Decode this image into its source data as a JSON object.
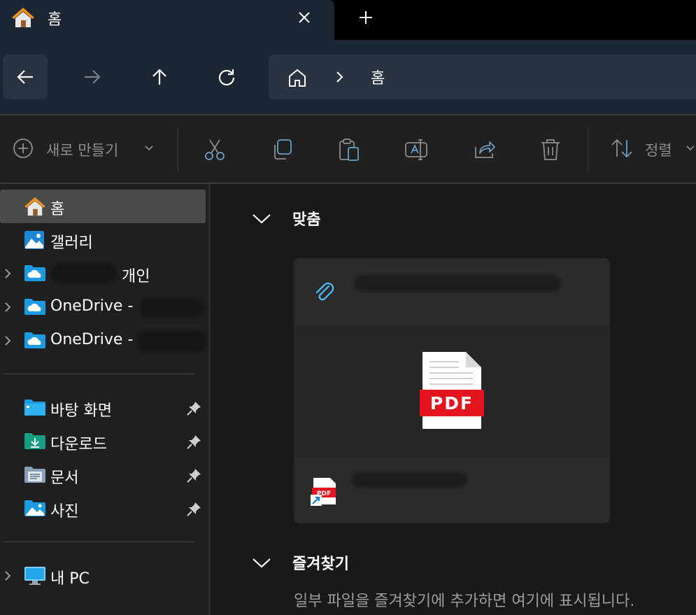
{
  "window": {
    "tab_title": "홈",
    "tab_close_icon": "close-icon",
    "new_tab_icon": "plus-icon"
  },
  "nav": {
    "back_icon": "arrow-left-icon",
    "forward_icon": "arrow-right-icon",
    "up_icon": "arrow-up-icon",
    "refresh_icon": "refresh-icon",
    "breadcrumb": {
      "home_icon": "home-icon",
      "separator": "›",
      "current": "홈"
    }
  },
  "toolbar": {
    "new_label": "새로 만들기",
    "cut_icon": "scissors-icon",
    "copy_icon": "copy-icon",
    "paste_icon": "clipboard-icon",
    "rename_icon": "rename-icon",
    "share_icon": "share-icon",
    "delete_icon": "trash-icon",
    "sort_label": "정렬"
  },
  "sidebar": {
    "items": [
      {
        "label": "홈",
        "icon": "home-icon",
        "selected": true
      },
      {
        "label": "갤러리",
        "icon": "gallery-icon"
      },
      {
        "label": "개인",
        "icon": "cloud-folder-icon",
        "expandable": true
      },
      {
        "label": "OneDrive -",
        "icon": "cloud-folder-icon",
        "expandable": true
      },
      {
        "label": "OneDrive -",
        "icon": "cloud-folder-icon",
        "expandable": true
      },
      {
        "label": "바탕 화면",
        "icon": "desktop-folder-icon",
        "pinned": true
      },
      {
        "label": "다운로드",
        "icon": "download-folder-icon",
        "pinned": true
      },
      {
        "label": "문서",
        "icon": "documents-folder-icon",
        "pinned": true
      },
      {
        "label": "사진",
        "icon": "pictures-folder-icon",
        "pinned": true
      },
      {
        "label": "내 PC",
        "icon": "computer-icon",
        "expandable": true
      }
    ]
  },
  "content": {
    "recommended_title": "맞춤",
    "card": {
      "attachment_icon": "paperclip-icon",
      "preview_label": "PDF",
      "file_icon": "pdf-shortcut-icon"
    },
    "favorites_title": "즐겨찾기",
    "favorites_empty": "일부 파일을 즐겨찾기에 추가하면 여기에 표시됩니다."
  },
  "colors": {
    "accent": "#4cc2ff",
    "pdf_red": "#e3141d",
    "home_orange": "#f7931e"
  }
}
